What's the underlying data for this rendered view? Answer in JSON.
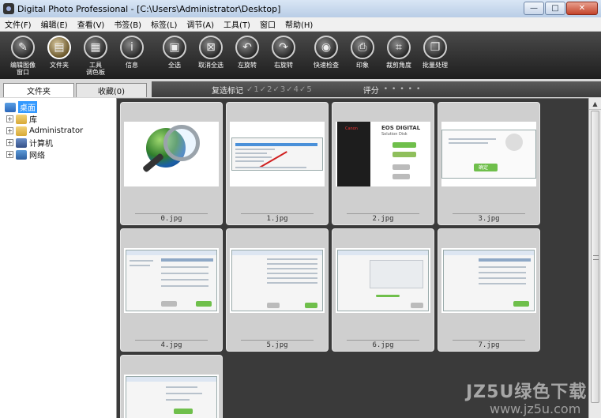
{
  "window": {
    "title": "Digital Photo Professional - [C:\\Users\\Administrator\\Desktop]",
    "minimize": "—",
    "maximize": "□",
    "close": "✕"
  },
  "menu": [
    "文件(F)",
    "编辑(E)",
    "查看(V)",
    "书签(B)",
    "标签(L)",
    "调节(A)",
    "工具(T)",
    "窗口",
    "帮助(H)"
  ],
  "toolbar": [
    {
      "label": "编辑图像\n窗口",
      "icon": "edit-window-icon"
    },
    {
      "label": "文件夹",
      "icon": "folder-icon"
    },
    {
      "label": "工具\n调色板",
      "icon": "tool-palette-icon"
    },
    {
      "label": "信息",
      "icon": "info-icon"
    },
    {
      "label": "全选",
      "icon": "select-all-icon"
    },
    {
      "label": "取消全选",
      "icon": "deselect-all-icon"
    },
    {
      "label": "左旋转",
      "icon": "rotate-left-icon"
    },
    {
      "label": "右旋转",
      "icon": "rotate-right-icon"
    },
    {
      "label": "快速检查",
      "icon": "quick-check-icon"
    },
    {
      "label": "印象",
      "icon": "print-icon"
    },
    {
      "label": "裁剪角度",
      "icon": "crop-angle-icon"
    },
    {
      "label": "批量处理",
      "icon": "batch-process-icon"
    }
  ],
  "tabs": {
    "folder": "文件夹",
    "collection": "收藏(0)"
  },
  "filter": {
    "check_mark_label": "复选标记",
    "check_marks": "✓1✓2✓3✓4✓5",
    "rating_label": "评分",
    "rating_dots": "•••••"
  },
  "tree": [
    {
      "label": "桌面",
      "expander": "",
      "selected": true
    },
    {
      "label": "库",
      "expander": "+"
    },
    {
      "label": "Administrator",
      "expander": "+"
    },
    {
      "label": "计算机",
      "expander": "+"
    },
    {
      "label": "网络",
      "expander": "+"
    }
  ],
  "thumbnails": [
    {
      "filename": "0.jpg"
    },
    {
      "filename": "1.jpg"
    },
    {
      "filename": "2.jpg"
    },
    {
      "filename": "3.jpg"
    },
    {
      "filename": "4.jpg"
    },
    {
      "filename": "5.jpg"
    },
    {
      "filename": "6.jpg"
    },
    {
      "filename": "7.jpg"
    },
    {
      "filename": ""
    }
  ],
  "thumb_text": {
    "t2_title": "EOS DIGITAL",
    "t2_sub": "Solution Disk",
    "t2_brand": "Canon",
    "t3_button": "确定"
  },
  "watermark": {
    "main": "JZ5U绿色下载",
    "sub": "www.jz5u.com"
  },
  "colors": {
    "toolbar_bg": "#1e1e1e",
    "grid_bg": "#3a3a3a",
    "cell_bg": "#cfcfcf",
    "selection": "#3399ff"
  }
}
